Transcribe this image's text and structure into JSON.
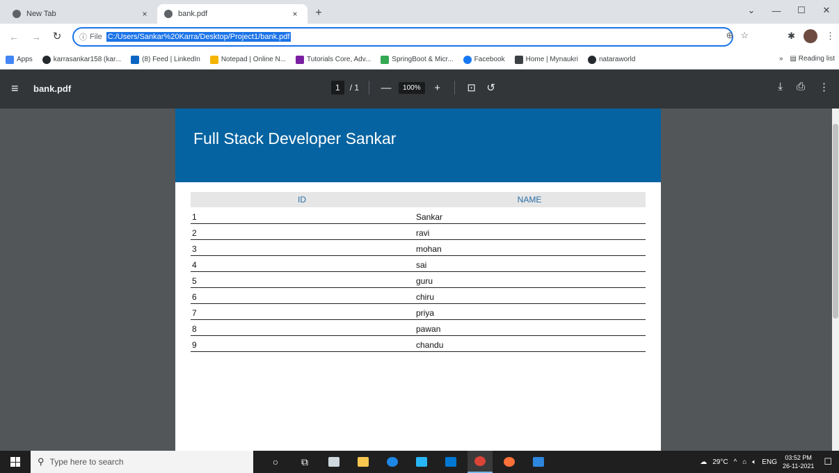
{
  "browser": {
    "tabs": [
      {
        "title": "New Tab",
        "close": "×"
      },
      {
        "title": "bank.pdf",
        "close": "×"
      }
    ],
    "newtab_label": "+",
    "window_controls": {
      "minimize": "—",
      "maximize": "☐",
      "close": "✕",
      "tablist": "⌄"
    },
    "address": {
      "scheme": "File",
      "url": "C:/Users/Sankar%20Karra/Desktop/Project1/bank.pdf"
    },
    "bookmarks": [
      {
        "label": "Apps",
        "color": "#4285f4"
      },
      {
        "label": "karrasankar158 (kar...",
        "color": "#24292e"
      },
      {
        "label": "(8) Feed | LinkedIn",
        "color": "#0a66c2"
      },
      {
        "label": "Notepad | Online N...",
        "color": "#f4b400"
      },
      {
        "label": "Tutorials Core, Adv...",
        "color": "#7b1fa2"
      },
      {
        "label": "SpringBoot & Micr...",
        "color": "#34a853"
      },
      {
        "label": "Facebook",
        "color": "#1877f2"
      },
      {
        "label": "Home | Mynaukri",
        "color": "#3c4043"
      },
      {
        "label": "nataraworld",
        "color": "#24292e"
      }
    ],
    "reading_list": "Reading list",
    "bookmarks_more": "»"
  },
  "pdf": {
    "file_name": "bank.pdf",
    "page_current": "1",
    "page_total": "/ 1",
    "zoom": "100%",
    "zoom_out": "—",
    "zoom_in": "+",
    "heading": "Full Stack Developer Sankar",
    "table": {
      "headers": [
        "ID",
        "NAME"
      ],
      "rows": [
        [
          "1",
          "Sankar"
        ],
        [
          "2",
          "ravi"
        ],
        [
          "3",
          "mohan"
        ],
        [
          "4",
          "sai"
        ],
        [
          "5",
          "guru"
        ],
        [
          "6",
          "chiru"
        ],
        [
          "7",
          "priya"
        ],
        [
          "8",
          "pawan"
        ],
        [
          "9",
          "chandu"
        ]
      ]
    }
  },
  "taskbar": {
    "search_placeholder": "Type here to search",
    "weather": "29°C",
    "language": "ENG",
    "time": "03:52 PM",
    "date": "26-11-2021"
  }
}
